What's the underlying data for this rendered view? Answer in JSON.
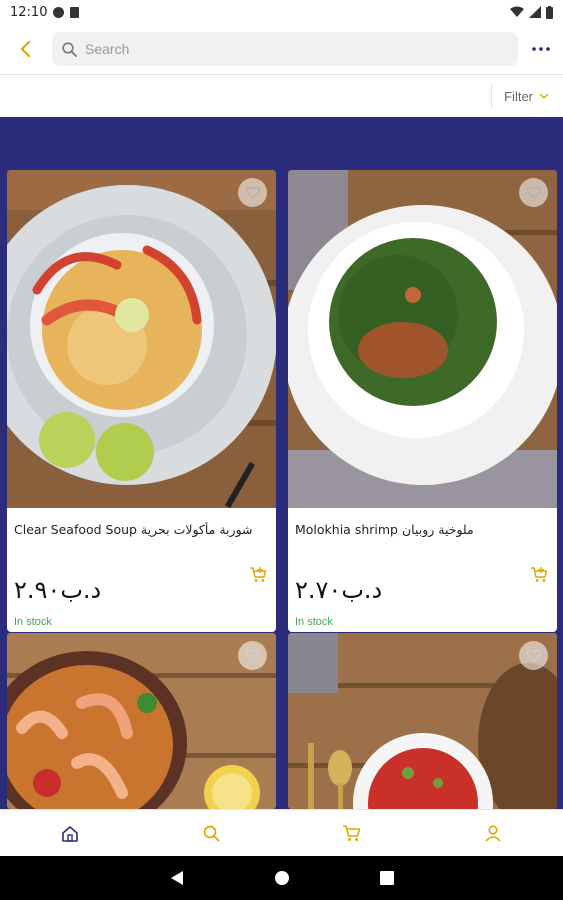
{
  "status_bar": {
    "time": "12:10",
    "icons": [
      "data-saver-icon",
      "sim-card-icon",
      "wifi-icon",
      "signal-icon",
      "battery-icon"
    ]
  },
  "app_bar": {
    "back_icon": "chevron-left-icon",
    "search": {
      "placeholder": "Search",
      "value": ""
    },
    "more_icon": "more-horizontal-icon"
  },
  "filter": {
    "label": "Filter",
    "icon": "chevron-down-icon"
  },
  "colors": {
    "accent": "#e0a800",
    "brand": "#2b2c7c",
    "stock": "#3fa65c"
  },
  "products": [
    {
      "title": "Clear Seafood Soup شوربة مأكولات بحرية",
      "price": "د.ب٢.٩٠",
      "stock": "In stock"
    },
    {
      "title": "Molokhia shrimp ملوخية روبيان",
      "price": "د.ب٢.٧٠",
      "stock": "In stock"
    },
    {
      "title": "",
      "price": "",
      "stock": ""
    },
    {
      "title": "",
      "price": "",
      "stock": ""
    }
  ],
  "bottom_nav": [
    "home-icon",
    "search-icon",
    "cart-icon",
    "profile-icon"
  ],
  "system_nav": [
    "back-triangle-icon",
    "home-circle-icon",
    "recents-square-icon"
  ]
}
